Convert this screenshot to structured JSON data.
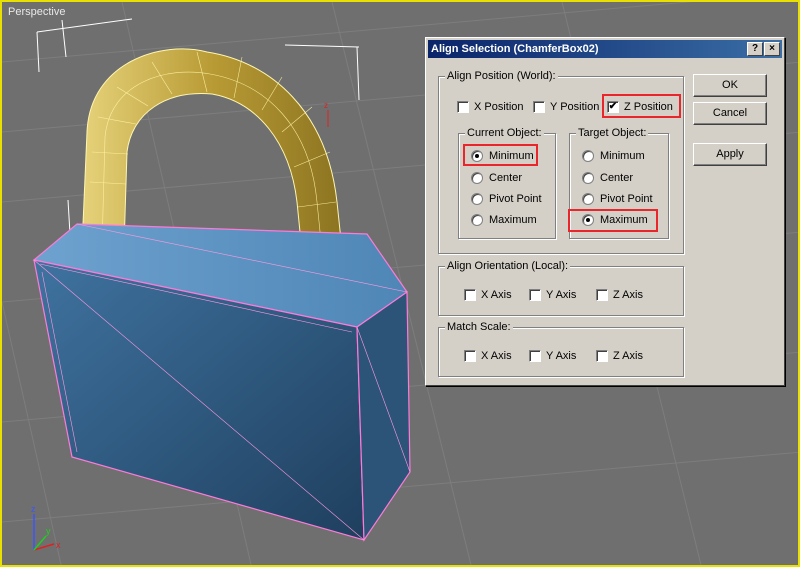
{
  "viewport": {
    "label": "Perspective",
    "axis_labels": {
      "x": "x",
      "y": "y",
      "z": "z"
    }
  },
  "dialog": {
    "title": "Align Selection (ChamferBox02)",
    "help_button": "?",
    "close_button": "×",
    "align_position": {
      "title": "Align Position (World):",
      "x_label": "X Position",
      "x_checked": false,
      "y_label": "Y Position",
      "y_checked": false,
      "z_label": "Z Position",
      "z_checked": true
    },
    "current_object": {
      "title": "Current Object:",
      "options": [
        "Minimum",
        "Center",
        "Pivot Point",
        "Maximum"
      ],
      "selected": "Minimum"
    },
    "target_object": {
      "title": "Target Object:",
      "options": [
        "Minimum",
        "Center",
        "Pivot Point",
        "Maximum"
      ],
      "selected": "Maximum"
    },
    "align_orientation": {
      "title": "Align Orientation (Local):",
      "x_label": "X Axis",
      "y_label": "Y Axis",
      "z_label": "Z Axis"
    },
    "match_scale": {
      "title": "Match Scale:",
      "x_label": "X Axis",
      "y_label": "Y Axis",
      "z_label": "Z Axis"
    },
    "buttons": {
      "ok": "OK",
      "cancel": "Cancel",
      "apply": "Apply"
    }
  },
  "colors": {
    "viewport_border": "#e8e000",
    "title_bar": "#0a246a",
    "highlight": "#e8262c",
    "lock_body": "#3d6a93",
    "shackle": "#c9b24a"
  }
}
